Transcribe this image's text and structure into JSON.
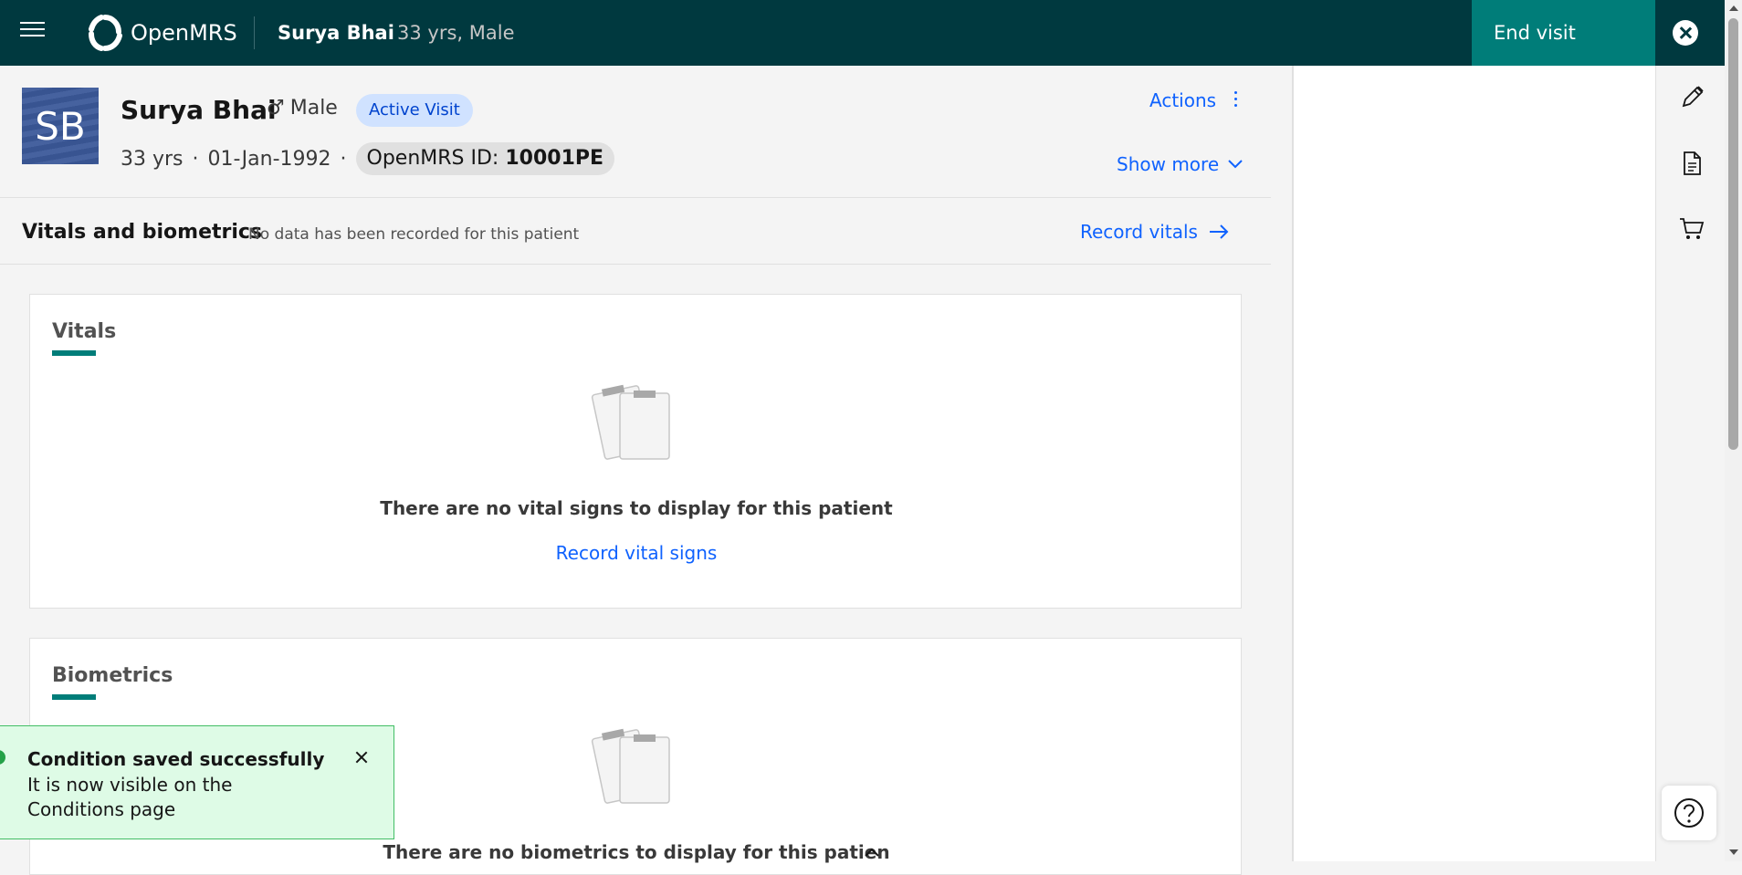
{
  "topbar": {
    "brand": "OpenMRS",
    "patient_name": "Surya Bhai",
    "patient_info": "33 yrs, Male",
    "end_visit_label": "End visit"
  },
  "banner": {
    "initials": "SB",
    "name": "Surya Bhai",
    "gender_symbol": "♂",
    "gender": "Male",
    "visit_tag": "Active Visit",
    "age": "33 yrs",
    "dob": "01-Jan-1992",
    "id_label": "OpenMRS ID:",
    "id_value": "10001PE",
    "separator": "·",
    "actions_label": "Actions",
    "show_more_label": "Show more"
  },
  "vitals_header": {
    "title": "Vitals and biometrics",
    "subtitle": "No data has been recorded for this patient",
    "record_label": "Record vitals"
  },
  "vitals_card": {
    "title": "Vitals",
    "empty_text": "There are no vital signs to display for this patient",
    "link_label": "Record vital signs"
  },
  "biometrics_card": {
    "title": "Biometrics",
    "empty_text": "There are no biometrics to display for this patien"
  },
  "toast": {
    "title": "Condition saved successfully",
    "message": "It is now visible on the Conditions page"
  },
  "icons": [
    "menu-icon",
    "openmrs-logo-icon",
    "close-icon",
    "pen-icon",
    "document-icon",
    "cart-icon",
    "help-icon",
    "chevron-down-icon",
    "arrow-right-icon",
    "overflow-menu-icon",
    "clipboard-empty-icon",
    "chevron-up-icon"
  ],
  "colors": {
    "topbar": "#00393f",
    "accent": "#007d79",
    "link": "#0f62fe",
    "visit_tag_bg": "#d0e2ff",
    "toast_bg": "#defbe6"
  }
}
